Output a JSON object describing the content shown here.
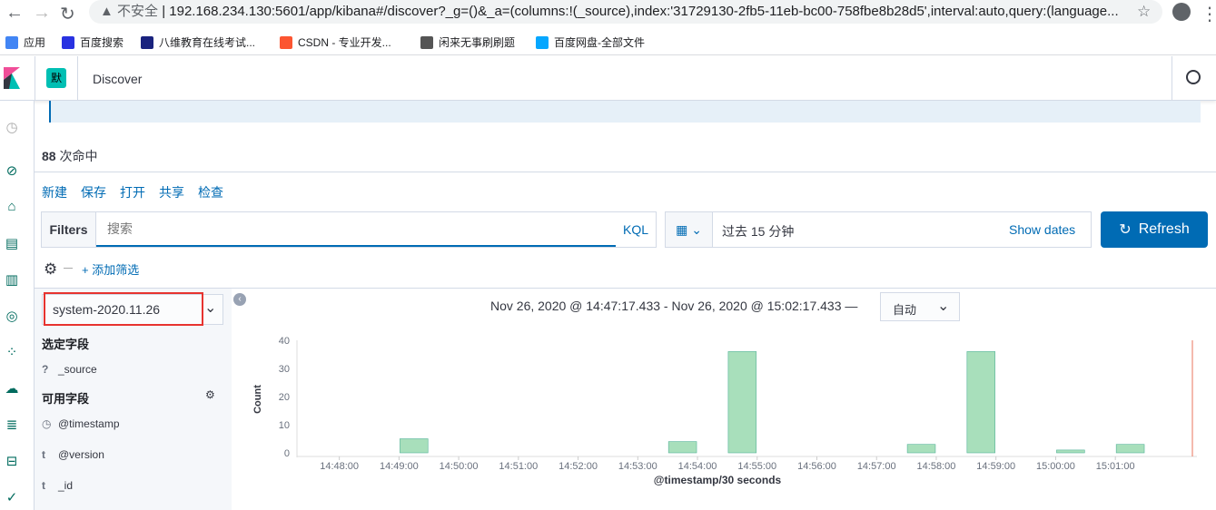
{
  "browser": {
    "security": "不安全",
    "url": "192.168.234.130:5601/app/kibana#/discover?_g=()&_a=(columns:!(_source),index:'31729130-2fb5-11eb-bc00-758fbe8b28d5',interval:auto,query:(language..."
  },
  "bookmarks": [
    {
      "label": "应用",
      "color": "#4285f4"
    },
    {
      "label": "百度搜索",
      "color": "#2932e1"
    },
    {
      "label": "八维教育在线考试...",
      "color": "#1a237e"
    },
    {
      "label": "CSDN - 专业开发...",
      "color": "#fc5531"
    },
    {
      "label": "闲来无事刷刷题",
      "color": "#555"
    },
    {
      "label": "百度网盘-全部文件",
      "color": "#06a7ff"
    }
  ],
  "header": {
    "space_badge": "默",
    "title": "Discover"
  },
  "hits": {
    "count": "88",
    "label": "次命中"
  },
  "menu": [
    "新建",
    "保存",
    "打开",
    "共享",
    "检查"
  ],
  "query": {
    "filters_label": "Filters",
    "placeholder": "搜索",
    "kql": "KQL",
    "time": "过去 15 分钟",
    "show_dates": "Show dates",
    "refresh": "Refresh",
    "add_filter": "+ 添加筛选"
  },
  "sidebar": {
    "index_pattern": "system-2020.11.26",
    "selected_heading": "选定字段",
    "selected": [
      {
        "type": "?",
        "name": "_source"
      }
    ],
    "available_heading": "可用字段",
    "available": [
      {
        "type": "clock",
        "name": "@timestamp"
      },
      {
        "type": "t",
        "name": "@version"
      },
      {
        "type": "t",
        "name": "_id"
      }
    ]
  },
  "chart_header": {
    "range": "Nov 26, 2020 @ 14:47:17.433 - Nov 26, 2020 @ 15:02:17.433 —",
    "interval": "自动"
  },
  "colors": {
    "accent": "#006bb4",
    "bar": "#a8dfbb",
    "bar_stroke": "#54b399",
    "now_line": "#e7664c"
  },
  "chart_data": {
    "type": "bar",
    "xlabel": "@timestamp/30 seconds",
    "ylabel": "Count",
    "ylim": [
      0,
      40
    ],
    "xlim": [
      "14:47:17.433",
      "15:02:17.433"
    ],
    "grid": false,
    "yticks": [
      0,
      10,
      20,
      30,
      40
    ],
    "xticks": [
      "14:48:00",
      "14:49:00",
      "14:50:00",
      "14:51:00",
      "14:52:00",
      "14:53:00",
      "14:54:00",
      "14:55:00",
      "14:56:00",
      "14:57:00",
      "14:58:00",
      "14:59:00",
      "15:00:00",
      "15:01:00"
    ],
    "x": [
      "14:49:00",
      "14:53:30",
      "14:54:30",
      "14:57:30",
      "14:58:30",
      "15:00:00",
      "15:01:00"
    ],
    "values": [
      5,
      4,
      36,
      3,
      36,
      1,
      3
    ]
  }
}
